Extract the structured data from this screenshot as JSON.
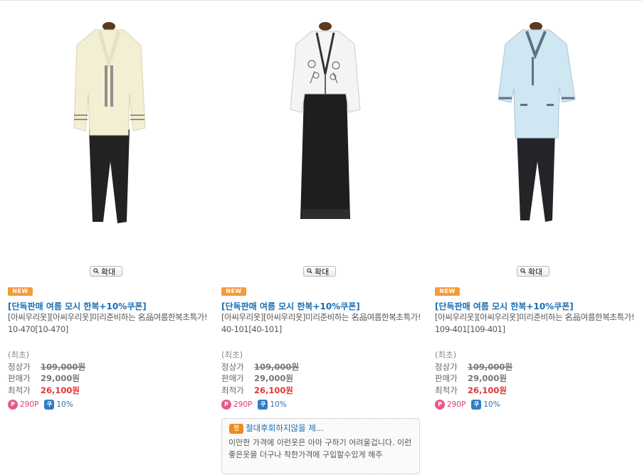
{
  "products": [
    {
      "zoom_label": "확대",
      "badge": "NEW",
      "title": "[단독판매 여름 모시 한복+10%쿠폰]",
      "desc": "[아씨우리옷][아씨우리옷]미리준비하는 名品여름한복초특가! 10-470[10-470]",
      "lowest_note": "(최초)",
      "regular_label": "정상가",
      "regular_price": "109,000원",
      "sale_label": "판매가",
      "sale_price": "29,000원",
      "best_label": "최적가",
      "best_price": "26,100원",
      "point_icon": "P",
      "point": "290P",
      "coupon_icon": "쿠",
      "coupon": "10%",
      "image": {
        "type": "hanbok-ivory",
        "colors": {
          "top": "#f3efd2",
          "trim": "#8f8f8f",
          "skirt": "#222222"
        }
      }
    },
    {
      "zoom_label": "확대",
      "badge": "NEW",
      "title": "[단독판매 여름 모시 한복+10%쿠폰]",
      "desc": "[아씨우리옷][아씨우리옷]미리준비하는 名品여름한복초특가! 40-101[40-101]",
      "lowest_note": "(최초)",
      "regular_label": "정상가",
      "regular_price": "109,000원",
      "sale_label": "판매가",
      "sale_price": "29,000원",
      "best_label": "최적가",
      "best_price": "26,100원",
      "point_icon": "P",
      "point": "290P",
      "coupon_icon": "쿠",
      "coupon": "10%",
      "image": {
        "type": "hanbok-white-black",
        "colors": {
          "top": "#f4f4f4",
          "trim": "#333333",
          "skirt": "#1d1f1d"
        }
      }
    },
    {
      "zoom_label": "확대",
      "badge": "NEW",
      "title": "[단독판매 여름 모시 한복+10%쿠폰]",
      "desc": "[아씨우리옷][아씨우리옷]미리준비하는 名品여름한복초특가! 109-401[109-401]",
      "lowest_note": "(최초)",
      "regular_label": "정상가",
      "regular_price": "109,000원",
      "sale_label": "판매가",
      "sale_price": "29,000원",
      "best_label": "최적가",
      "best_price": "26,100원",
      "point_icon": "P",
      "point": "290P",
      "coupon_icon": "쿠",
      "coupon": "10%",
      "image": {
        "type": "hanbok-skyblue",
        "colors": {
          "top": "#cfe6f3",
          "trim": "#607080",
          "skirt": "#222428"
        }
      }
    }
  ],
  "review": {
    "icon": "평",
    "title": "절대후회하지않을 제...",
    "body": "이만한 가격에 이런옷은 아마 구하기 어려울겁니다. 이런 좋은옷을 더구나 착한가격에 구입할수있게 해주"
  }
}
